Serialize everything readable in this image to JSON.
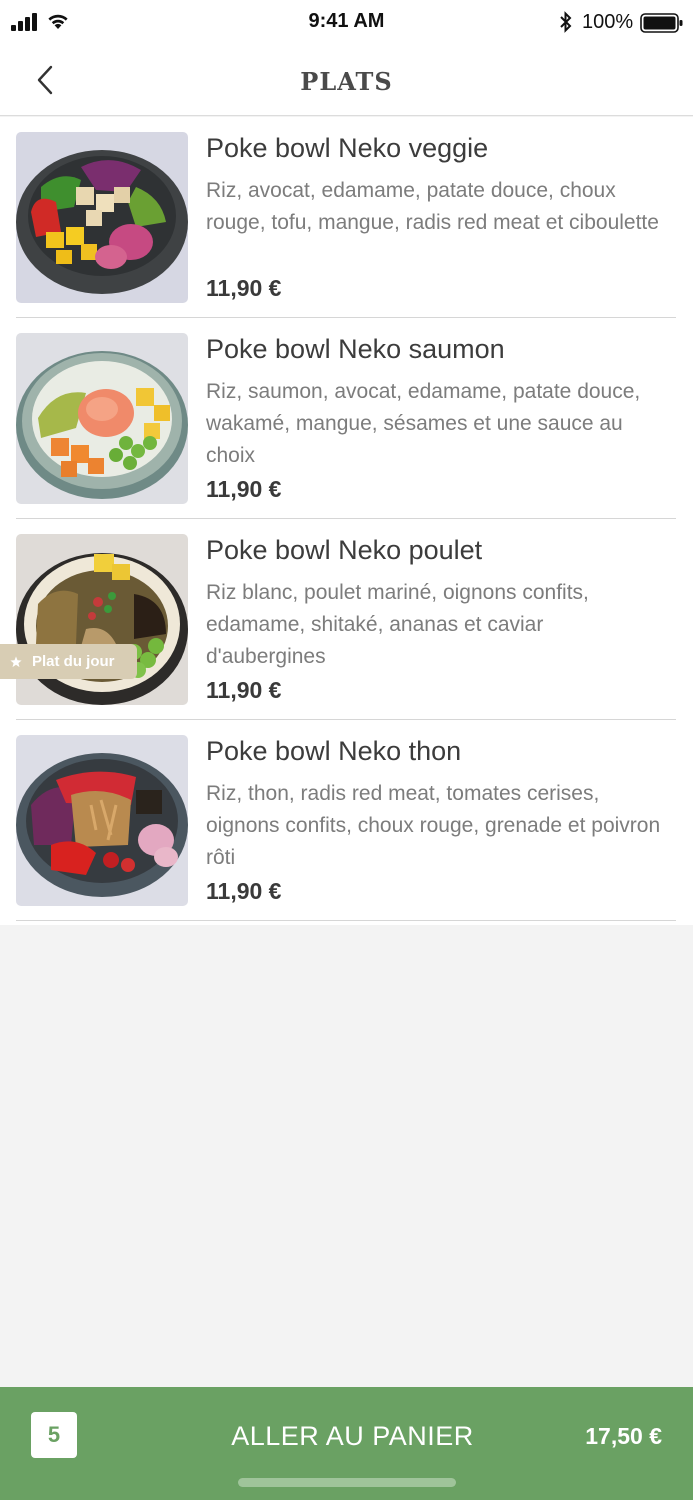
{
  "status_bar": {
    "time": "9:41 AM",
    "battery_percent": "100%",
    "battery_level": 1.0
  },
  "nav": {
    "title": "PLATS",
    "back_icon": "chevron-left-icon"
  },
  "items": [
    {
      "name": "Poke bowl Neko veggie",
      "description": "Riz, avocat, edamame, patate douce, choux rouge, tofu, mangue, radis red meat et ciboulette",
      "price": "11,90 €"
    },
    {
      "name": "Poke bowl Neko saumon",
      "description": "Riz, saumon, avocat, edamame, patate douce, wakamé, mangue, sésames et une sauce au choix",
      "price": "11,90 €"
    },
    {
      "name": "Poke bowl Neko poulet",
      "description": "Riz blanc, poulet mariné, oignons confits, edamame, shitaké, ananas et caviar d'aubergines",
      "price": "11,90 €",
      "badge": "Plat du jour"
    },
    {
      "name": "Poke bowl Neko thon",
      "description": "Riz, thon, radis red meat, tomates cerises, oignons confits, choux rouge, grenade et poivron rôti",
      "price": "11,90 €"
    }
  ],
  "cart": {
    "count": "5",
    "label": "ALLER AU PANIER",
    "total": "17,50 €"
  },
  "colors": {
    "accent_green": "#6aa163",
    "badge": "#d8cdb4"
  }
}
